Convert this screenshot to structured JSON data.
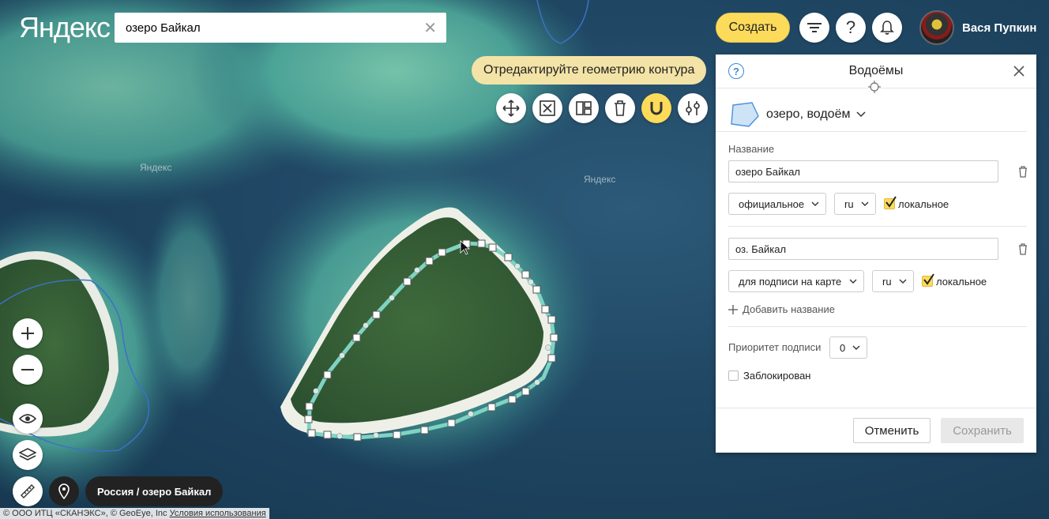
{
  "header": {
    "logo": "Яндекс",
    "search_value": "озеро Байкал",
    "create_label": "Создать",
    "user_name": "Вася Пупкин"
  },
  "map": {
    "watermarks": [
      "Яндекс",
      "Яндекс"
    ],
    "hint": "Отредактируйте геометрию контура",
    "breadcrumb": "Россия / озеро Байкал",
    "copyright": "© ООО ИТЦ «СКАНЭКС», © GeoEye, Inc",
    "terms_link": "Условия использования"
  },
  "toolbar_icons": [
    "move-icon",
    "delete-vertex-icon",
    "split-icon",
    "trash-icon",
    "magnet-icon",
    "settings-icon"
  ],
  "panel": {
    "title": "Водоёмы",
    "object_type": "озеро, водоём",
    "name_label": "Название",
    "names": [
      {
        "value": "озеро Байкал",
        "type": "официальное",
        "lang": "ru",
        "local_label": "локальное",
        "local": true
      },
      {
        "value": "оз. Байкал",
        "type": "для подписи на карте",
        "lang": "ru",
        "local_label": "локальное",
        "local": true
      }
    ],
    "add_name": "Добавить название",
    "priority_label": "Приоритет подписи",
    "priority_value": "0",
    "locked_label": "Заблокирован",
    "locked": false,
    "cancel": "Отменить",
    "save": "Сохранить"
  },
  "colors": {
    "accent": "#fddb5a",
    "contour": "#7fd3c3",
    "water": "#1f4663"
  }
}
